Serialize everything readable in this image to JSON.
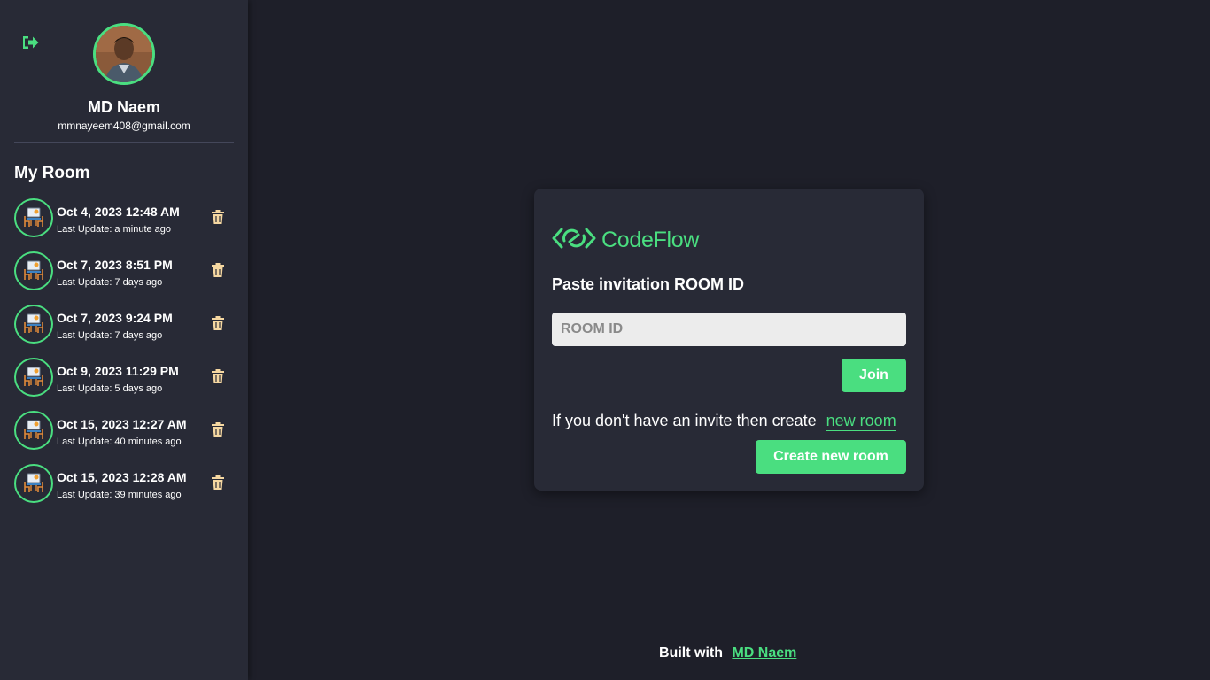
{
  "sidebar": {
    "user": {
      "name": "MD Naem",
      "email": "mmnayeem408@gmail.com"
    },
    "section_title": "My Room",
    "rooms": [
      {
        "title": "Oct 4, 2023 12:48 AM",
        "subtitle": "Last Update: a minute ago"
      },
      {
        "title": "Oct 7, 2023 8:51 PM",
        "subtitle": "Last Update: 7 days ago"
      },
      {
        "title": "Oct 7, 2023 9:24 PM",
        "subtitle": "Last Update: 7 days ago"
      },
      {
        "title": "Oct 9, 2023 11:29 PM",
        "subtitle": "Last Update: 5 days ago"
      },
      {
        "title": "Oct 15, 2023 12:27 AM",
        "subtitle": "Last Update: 40 minutes ago"
      },
      {
        "title": "Oct 15, 2023 12:28 AM",
        "subtitle": "Last Update: 39 minutes ago"
      }
    ]
  },
  "card": {
    "brand": "CodeFlow",
    "heading": "Paste invitation ROOM ID",
    "room_input": {
      "placeholder": "ROOM ID",
      "value": ""
    },
    "join_label": "Join",
    "invite_text": "If you don't have an invite then create",
    "new_room_link": "new room",
    "create_label": "Create new room"
  },
  "footer": {
    "text": "Built with",
    "link": "MD Naem"
  },
  "colors": {
    "accent": "#4ade80",
    "background": "#1e1f29",
    "panel": "#282a36",
    "trash": "#f5d7a1"
  },
  "icons": {
    "logout": "logout-icon",
    "trash": "trash-icon",
    "room": "room-icon",
    "brand": "codeflow-logo-icon"
  }
}
